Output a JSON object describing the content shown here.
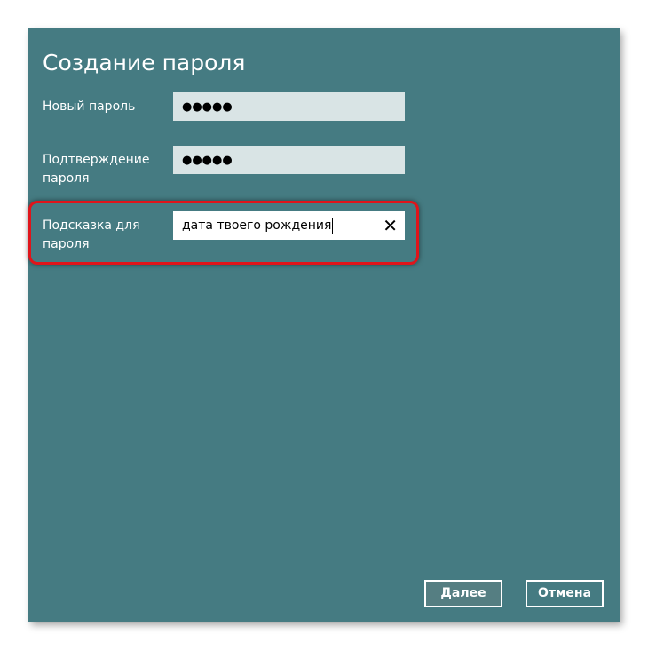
{
  "dialog": {
    "title": "Создание пароля",
    "new_password": {
      "label": "Новый пароль",
      "value": "●●●●●"
    },
    "confirm_password": {
      "label": "Подтверждение пароля",
      "value": "●●●●●"
    },
    "hint": {
      "label": "Подсказка для пароля",
      "value": "дата твоего рождения",
      "clear_icon": "✕"
    },
    "buttons": {
      "next": "Далее",
      "cancel": "Отмена"
    }
  },
  "colors": {
    "panel": "#457b82",
    "highlight": "#e0141a",
    "field": "#d9e4e5"
  }
}
